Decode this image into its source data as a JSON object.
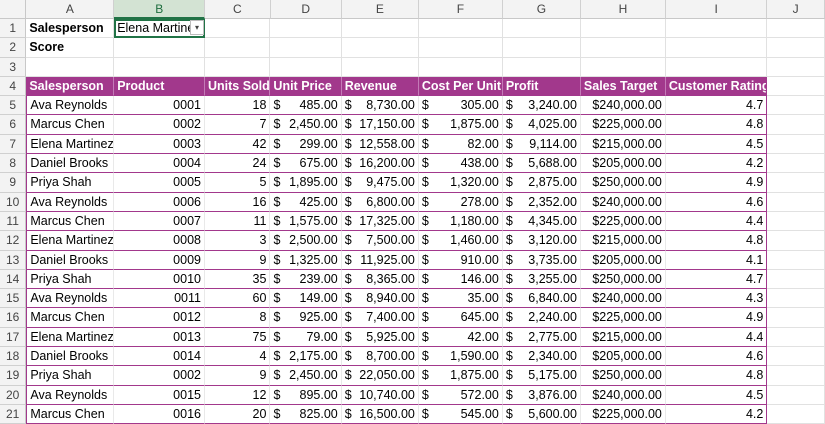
{
  "columns": [
    "A",
    "B",
    "C",
    "D",
    "E",
    "F",
    "G",
    "H",
    "I",
    "J"
  ],
  "selected_column": "B",
  "row_numbers": [
    "1",
    "2",
    "3",
    "4",
    "5",
    "6",
    "7",
    "8",
    "9",
    "10",
    "11",
    "12",
    "13",
    "14",
    "15",
    "16",
    "17",
    "18",
    "19",
    "20",
    "21"
  ],
  "filter": {
    "label1": "Salesperson",
    "label2": "Score",
    "selected_value": "Elena Martinez",
    "dropdown_icon": "chevron-down-icon"
  },
  "table": {
    "header_color": "#a2388c",
    "headers": [
      "Salesperson",
      "Product",
      "Units Sold",
      "Unit Price",
      "Revenue",
      "Cost Per Unit",
      "Profit",
      "Sales Target",
      "Customer Rating"
    ],
    "rows": [
      [
        "Ava Reynolds",
        "0001",
        "18",
        "485.00",
        "8,730.00",
        "305.00",
        "3,240.00",
        "$240,000.00",
        "4.7"
      ],
      [
        "Marcus Chen",
        "0002",
        "7",
        "2,450.00",
        "17,150.00",
        "1,875.00",
        "4,025.00",
        "$225,000.00",
        "4.8"
      ],
      [
        "Elena Martinez",
        "0003",
        "42",
        "299.00",
        "12,558.00",
        "82.00",
        "9,114.00",
        "$215,000.00",
        "4.5"
      ],
      [
        "Daniel Brooks",
        "0004",
        "24",
        "675.00",
        "16,200.00",
        "438.00",
        "5,688.00",
        "$205,000.00",
        "4.2"
      ],
      [
        "Priya Shah",
        "0005",
        "5",
        "1,895.00",
        "9,475.00",
        "1,320.00",
        "2,875.00",
        "$250,000.00",
        "4.9"
      ],
      [
        "Ava Reynolds",
        "0006",
        "16",
        "425.00",
        "6,800.00",
        "278.00",
        "2,352.00",
        "$240,000.00",
        "4.6"
      ],
      [
        "Marcus Chen",
        "0007",
        "11",
        "1,575.00",
        "17,325.00",
        "1,180.00",
        "4,345.00",
        "$225,000.00",
        "4.4"
      ],
      [
        "Elena Martinez",
        "0008",
        "3",
        "2,500.00",
        "7,500.00",
        "1,460.00",
        "3,120.00",
        "$215,000.00",
        "4.8"
      ],
      [
        "Daniel Brooks",
        "0009",
        "9",
        "1,325.00",
        "11,925.00",
        "910.00",
        "3,735.00",
        "$205,000.00",
        "4.1"
      ],
      [
        "Priya Shah",
        "0010",
        "35",
        "239.00",
        "8,365.00",
        "146.00",
        "3,255.00",
        "$250,000.00",
        "4.7"
      ],
      [
        "Ava Reynolds",
        "0011",
        "60",
        "149.00",
        "8,940.00",
        "35.00",
        "6,840.00",
        "$240,000.00",
        "4.3"
      ],
      [
        "Marcus Chen",
        "0012",
        "8",
        "925.00",
        "7,400.00",
        "645.00",
        "2,240.00",
        "$225,000.00",
        "4.9"
      ],
      [
        "Elena Martinez",
        "0013",
        "75",
        "79.00",
        "5,925.00",
        "42.00",
        "2,775.00",
        "$215,000.00",
        "4.4"
      ],
      [
        "Daniel Brooks",
        "0014",
        "4",
        "2,175.00",
        "8,700.00",
        "1,590.00",
        "2,340.00",
        "$205,000.00",
        "4.6"
      ],
      [
        "Priya Shah",
        "0002",
        "9",
        "2,450.00",
        "22,050.00",
        "1,875.00",
        "5,175.00",
        "$250,000.00",
        "4.8"
      ],
      [
        "Ava Reynolds",
        "0015",
        "12",
        "895.00",
        "10,740.00",
        "572.00",
        "3,876.00",
        "$240,000.00",
        "4.5"
      ],
      [
        "Marcus Chen",
        "0016",
        "20",
        "825.00",
        "16,500.00",
        "545.00",
        "5,600.00",
        "$225,000.00",
        "4.2"
      ]
    ]
  }
}
